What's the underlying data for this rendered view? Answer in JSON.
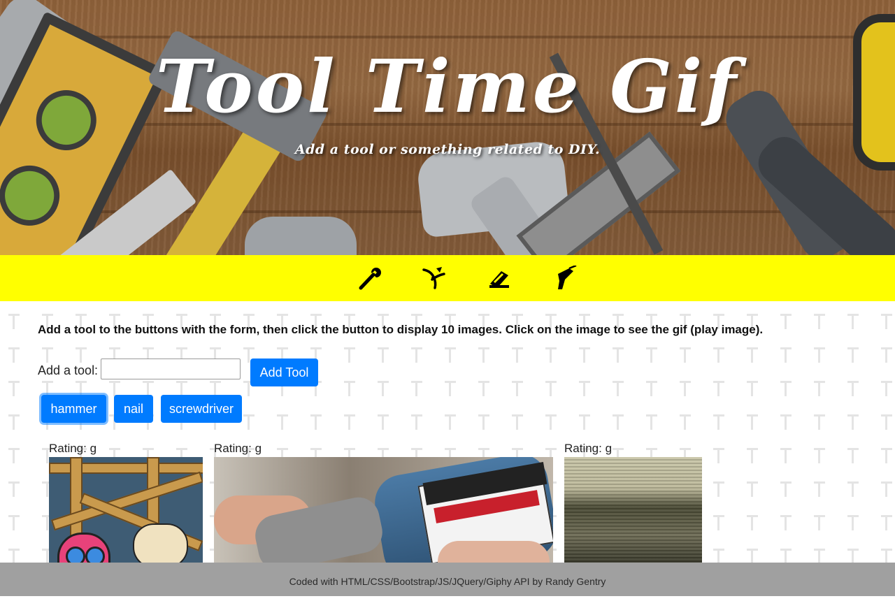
{
  "hero": {
    "title": "Tool Time Gif",
    "subtitle": "Add a tool or something related to DIY."
  },
  "iconbar": {
    "background": "#ffff00",
    "icons": [
      "wrench-icon",
      "pliers-icon",
      "stapler-icon",
      "drill-icon"
    ]
  },
  "main": {
    "instructions": "Add a tool to the buttons with the form, then click the button to display 10 images. Click on the image to see the gif (play image).",
    "form": {
      "label": "Add a tool:",
      "input_value": "",
      "submit_label": "Add Tool"
    },
    "tool_buttons": [
      "hammer",
      "nail",
      "screwdriver"
    ],
    "selected_tool": "hammer",
    "gifs": [
      {
        "rating": "Rating: g"
      },
      {
        "rating": "Rating: g"
      },
      {
        "rating": "Rating: g"
      }
    ]
  },
  "colors": {
    "primary": "#007bff",
    "iconbar": "#ffff00",
    "footer": "#a0a0a0"
  },
  "footer": {
    "text": "Coded with HTML/CSS/Bootstrap/JS/JQuery/Giphy API by Randy Gentry"
  }
}
